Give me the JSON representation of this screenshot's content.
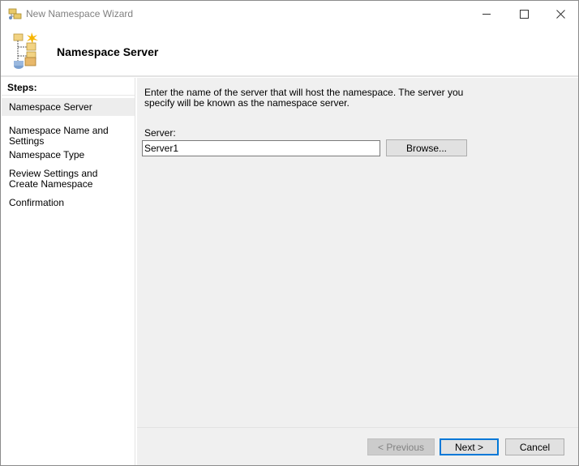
{
  "window": {
    "title": "New Namespace Wizard",
    "icon": "namespace-wizard-icon"
  },
  "titlebar_controls": {
    "minimize_icon": "minimize-icon",
    "maximize_icon": "maximize-icon",
    "close_icon": "close-icon"
  },
  "header": {
    "title": "Namespace Server",
    "icon": "namespace-folders-icon"
  },
  "steps": {
    "heading": "Steps:",
    "items": [
      {
        "label": "Namespace Server",
        "active": true
      },
      {
        "label": "Namespace Name and Settings",
        "active": false
      },
      {
        "label": "Namespace Type",
        "active": false
      },
      {
        "label": "Review Settings and Create Namespace",
        "active": false
      },
      {
        "label": "Confirmation",
        "active": false
      }
    ]
  },
  "content": {
    "description": "Enter the name of the server that will host the namespace. The server you specify will be known as the namespace server.",
    "server_label": "Server:",
    "server_value": "Server1",
    "browse_label": "Browse..."
  },
  "buttons": {
    "previous": "< Previous",
    "next": "Next >",
    "cancel": "Cancel"
  },
  "colors": {
    "content_bg": "#f0f0f0",
    "active_step_bg": "#ededed",
    "default_button_border": "#0078d7",
    "disabled_text": "#838383",
    "title_text": "#808080"
  }
}
